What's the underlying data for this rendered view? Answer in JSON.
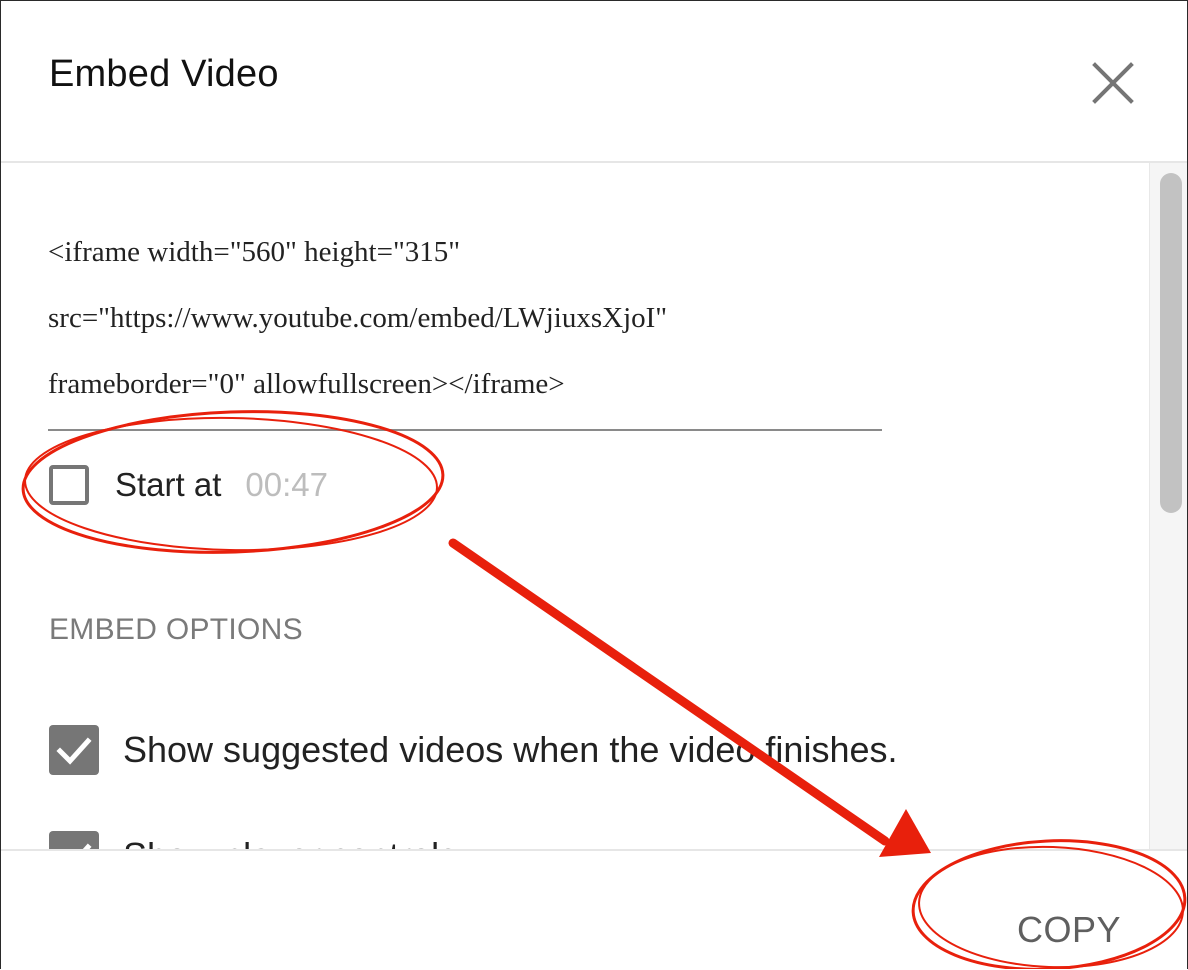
{
  "dialog": {
    "title": "Embed Video",
    "close_icon": "close-icon"
  },
  "embed_code": {
    "lines": [
      "<iframe width=\"560\" height=\"315\"",
      "src=\"https://www.youtube.com/embed/LWjiuxsXjoI\"",
      "frameborder=\"0\" allowfullscreen></iframe>"
    ]
  },
  "start_at": {
    "label": "Start at",
    "time": "00:47",
    "checked": false
  },
  "embed_options": {
    "title": "EMBED OPTIONS",
    "options": [
      {
        "label": "Show suggested videos when the video finishes.",
        "checked": true
      },
      {
        "label": "Show player controls.",
        "checked": true
      }
    ]
  },
  "footer": {
    "copy_label": "COPY"
  },
  "colors": {
    "annotation_red": "#e8200c",
    "checkbox_gray": "#767676",
    "muted_text": "#bdbdbd"
  }
}
